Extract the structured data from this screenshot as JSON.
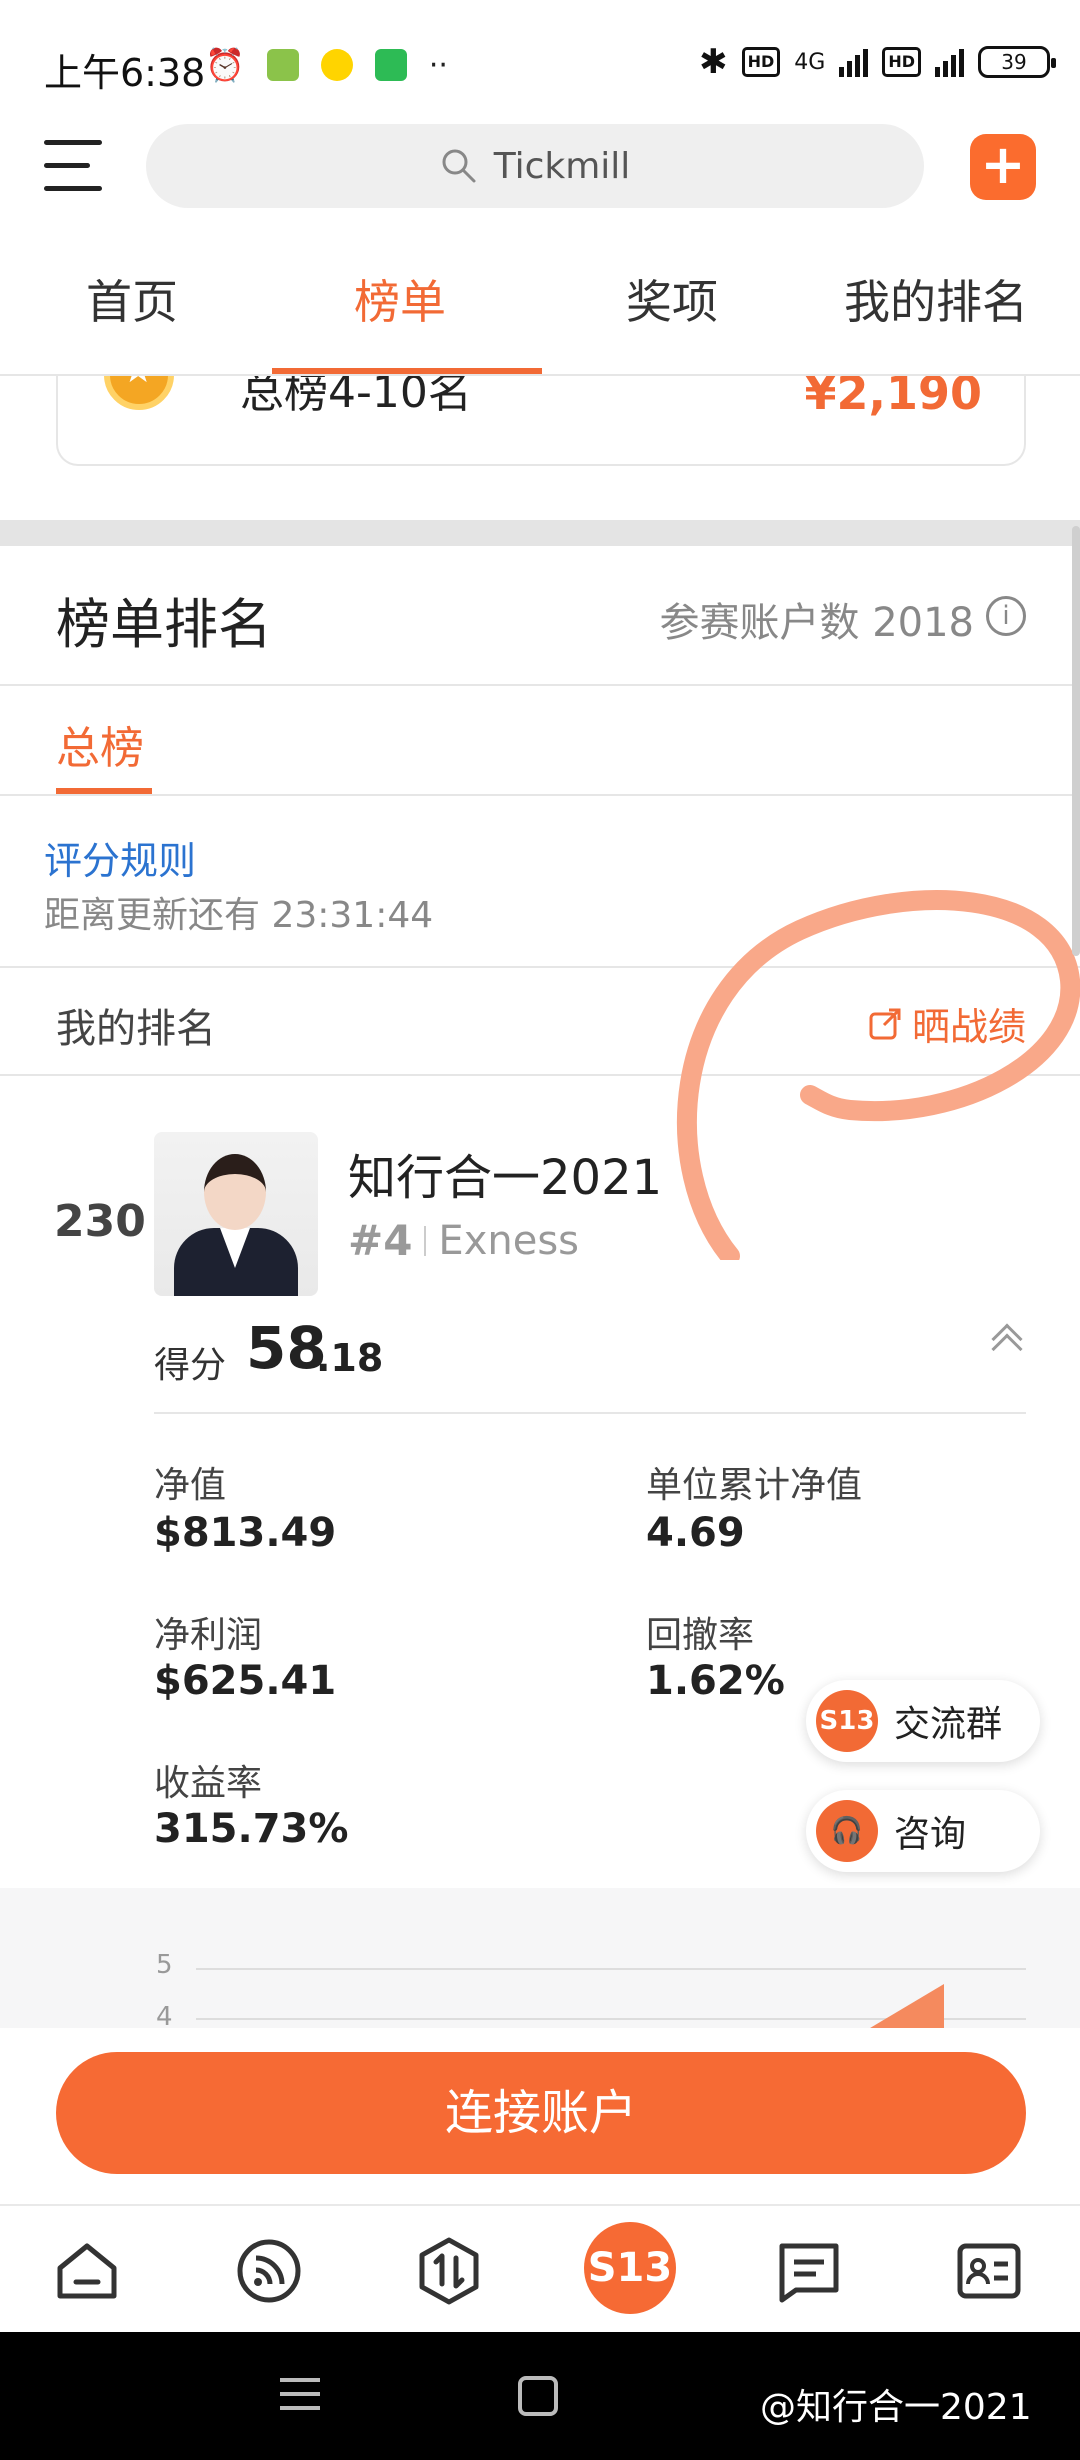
{
  "status_bar": {
    "time": "上午6:38",
    "network": "4G",
    "battery": "39"
  },
  "search": {
    "placeholder": "Tickmill"
  },
  "tabs": [
    {
      "label": "首页"
    },
    {
      "label": "榜单",
      "active": true
    },
    {
      "label": "奖项"
    },
    {
      "label": "我的排名"
    }
  ],
  "prize": {
    "label": "总榜4-10名",
    "amount": "¥2,190"
  },
  "ranking": {
    "title": "榜单排名",
    "participants": "参赛账户数 2018",
    "subtab": "总榜",
    "rules_link": "评分规则",
    "countdown": "距离更新还有 23:31:44",
    "my_rank_label": "我的排名",
    "share_label": "晒战绩"
  },
  "entry": {
    "rank": "230",
    "name": "知行合一2021",
    "broker_rank": "#4",
    "broker": "Exness",
    "score_label": "得分",
    "score_int": "58",
    "score_dec": ".18",
    "stats": [
      {
        "label": "净值",
        "value": "$813.49"
      },
      {
        "label": "单位累计净值",
        "value": "4.69"
      },
      {
        "label": "净利润",
        "value": "$625.41"
      },
      {
        "label": "回撤率",
        "value": "1.62%"
      },
      {
        "label": "收益率",
        "value": "315.73%"
      }
    ]
  },
  "float_buttons": {
    "group": "交流群",
    "consult": "咨询",
    "badge": "S13"
  },
  "chart": {
    "ticks": [
      "5",
      "4"
    ]
  },
  "connect_button": "连接账户",
  "bottom_nav": [
    "home-icon",
    "feed-icon",
    "trade-icon",
    "s13-icon",
    "message-icon",
    "profile-card-icon"
  ],
  "watermark": "@知行合一2021",
  "colors": {
    "accent": "#f26a35",
    "link": "#2b73d0"
  }
}
